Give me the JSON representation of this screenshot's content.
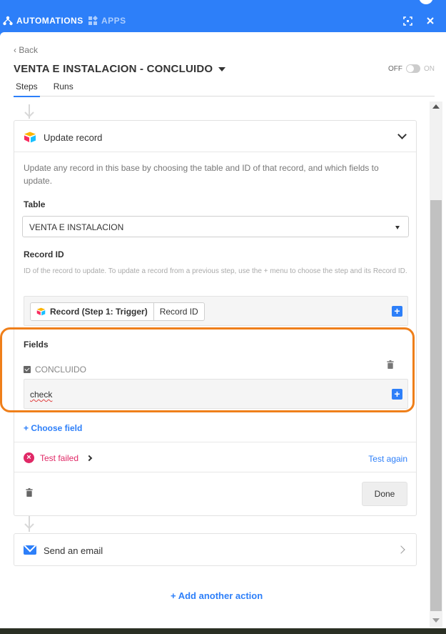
{
  "topbar": {
    "automations_label": "AUTOMATIONS",
    "apps_label": "APPS",
    "bg_color": "#2d7ff9",
    "icons": [
      "automations-icon",
      "apps-icon",
      "expand-icon",
      "close-icon"
    ]
  },
  "header": {
    "back_label": "Back",
    "title": "VENTA E INSTALACION - CONCLUIDO",
    "toggle_off_label": "OFF",
    "toggle_on_label": "ON",
    "toggle_state": "off"
  },
  "tabs": [
    {
      "label": "Steps",
      "active": true
    },
    {
      "label": "Runs",
      "active": false
    }
  ],
  "update_card": {
    "title": "Update record",
    "description": "Update any record in this base by choosing the table and ID of that record, and which fields to update.",
    "table_label": "Table",
    "table_value": "VENTA E INSTALACION",
    "record_id_label": "Record ID",
    "record_id_hint": "ID of the record to update. To update a record from a previous step, use the + menu to choose the step and its Record ID.",
    "token_source": "Record (Step 1: Trigger)",
    "token_field": "Record ID",
    "fields_label": "Fields",
    "field_name": "CONCLUIDO",
    "field_value": "check",
    "choose_field_label": "+ Choose field",
    "test_status": "Test failed",
    "test_again_label": "Test again",
    "done_label": "Done",
    "highlight_color": "#ef7f1a",
    "error_color": "#e02866"
  },
  "email_card": {
    "title": "Send an email"
  },
  "add_action_label": "+ Add another action"
}
